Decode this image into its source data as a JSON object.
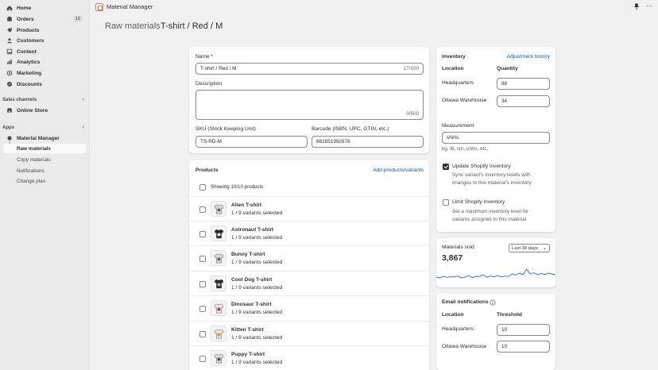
{
  "topbar": {
    "app_title": "Material Manager"
  },
  "sidebar": {
    "items": [
      {
        "label": "Home",
        "icon": "home-icon"
      },
      {
        "label": "Orders",
        "icon": "orders-icon",
        "badge": "12"
      },
      {
        "label": "Products",
        "icon": "products-icon"
      },
      {
        "label": "Customers",
        "icon": "customers-icon"
      },
      {
        "label": "Content",
        "icon": "content-icon"
      },
      {
        "label": "Analytics",
        "icon": "analytics-icon"
      },
      {
        "label": "Marketing",
        "icon": "marketing-icon"
      },
      {
        "label": "Discounts",
        "icon": "discounts-icon"
      }
    ],
    "sales_channels_label": "Sales channels",
    "online_store_label": "Online Store",
    "apps_label": "Apps",
    "app_name": "Material Manager",
    "app_subitems": [
      "Raw materials",
      "Copy materials",
      "Notifications",
      "Change plan"
    ]
  },
  "header": {
    "breadcrumb": "Raw materials",
    "title": "T-shirt / Red / M"
  },
  "details": {
    "name_label": "Name *",
    "name_value": "T-shirt / Red / M",
    "name_count": "17/100",
    "description_label": "Description",
    "description_count": "0/500",
    "sku_label": "SKU (Stock Keeping Unit)",
    "sku_value": "TS-RD-M",
    "barcode_label": "Barcode (ISBN, UPC, GTIN, etc.)",
    "barcode_value": "662851992678"
  },
  "products": {
    "title": "Products",
    "add_link": "Add products/variants",
    "showing": "Showing 10/10 products",
    "rows": [
      {
        "name": "Alien T-shirt",
        "sub": "1 / 9 variants selected"
      },
      {
        "name": "Astronaut T-shirt",
        "sub": "1 / 9 variants selected"
      },
      {
        "name": "Bunny T-shirt",
        "sub": "1 / 9 variants selected"
      },
      {
        "name": "Cool Dog T-shirt",
        "sub": "1 / 9 variants selected"
      },
      {
        "name": "Dinosaur T-shirt",
        "sub": "1 / 9 variants selected"
      },
      {
        "name": "Kitten T-shirt",
        "sub": "1 / 9 variants selected"
      },
      {
        "name": "Puppy T-shirt",
        "sub": "1 / 9 variants selected"
      }
    ]
  },
  "inventory": {
    "title": "Inventory",
    "history_link": "Adjustment history",
    "col_location": "Location",
    "col_quantity": "Quantity",
    "rows": [
      {
        "location": "Headquarters",
        "quantity": "88"
      },
      {
        "location": "Ottawa Warehouse",
        "quantity": "34"
      }
    ],
    "measurement_label": "Measurement",
    "measurement_value": "shirts",
    "measurement_hint": "kg, lb, cm, units, etc.",
    "update_label": "Update Shopify inventory",
    "update_hint_1": "Sync variant's inventory levels with",
    "update_hint_2": "changes to this material's inventory",
    "limit_label": "Limit Shopify inventory",
    "limit_hint_1": "Set a maximum inventory level for",
    "limit_hint_2": "variants assigned to this material"
  },
  "sales": {
    "title": "Materials sold",
    "value": "3,867",
    "period": "Last 30 days",
    "sparkline": [
      0.35,
      0.3,
      0.4,
      0.33,
      0.38,
      0.36,
      0.42,
      0.3,
      0.35,
      0.45,
      0.32,
      0.4,
      0.38,
      0.5,
      0.34,
      0.42,
      0.37,
      0.44,
      0.36,
      0.41,
      0.39,
      0.55,
      0.48,
      0.6,
      0.5,
      0.85,
      0.55,
      0.62,
      0.5,
      0.58,
      0.52,
      0.6,
      0.55,
      0.5
    ],
    "accent": "#2c6ecb"
  },
  "notifications": {
    "title": "Email notifications",
    "col_location": "Location",
    "col_threshold": "Threshold",
    "rows": [
      {
        "location": "Headquarters",
        "threshold": "10"
      },
      {
        "location": "Ottawa Warehouse",
        "threshold": "10"
      }
    ]
  }
}
